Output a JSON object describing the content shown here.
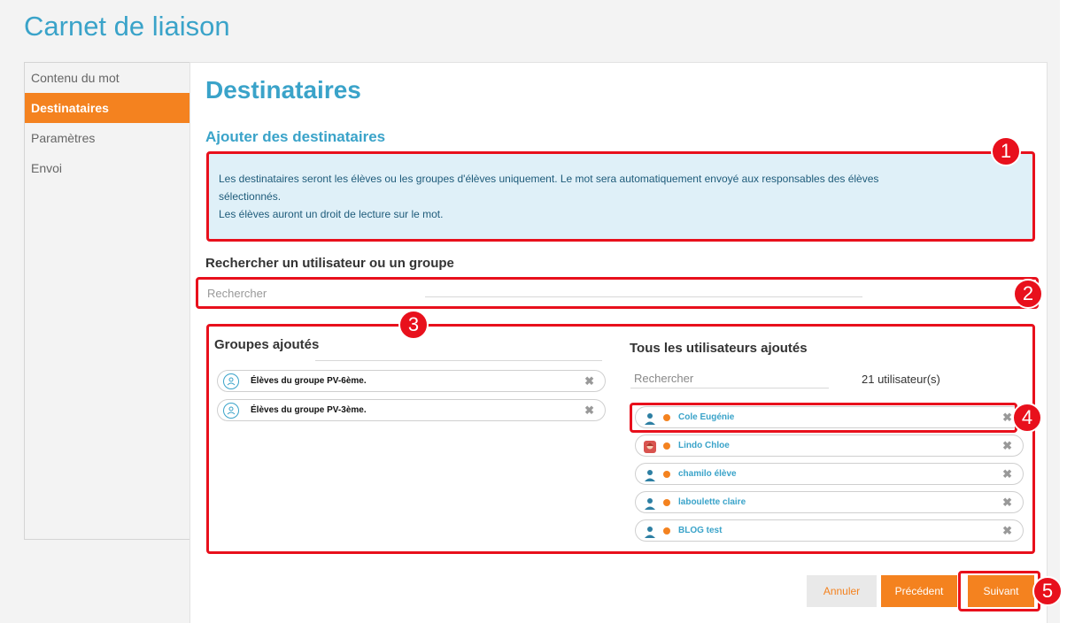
{
  "app": {
    "title": "Carnet de liaison"
  },
  "sidebar": {
    "items": [
      {
        "label": "Contenu du mot"
      },
      {
        "label": "Destinataires"
      },
      {
        "label": "Paramètres"
      },
      {
        "label": "Envoi"
      }
    ]
  },
  "main": {
    "title": "Destinataires",
    "subtitle": "Ajouter des destinataires",
    "info": {
      "line1": "Les destinataires seront les élèves ou les groupes d'élèves uniquement. Le mot sera automatiquement envoyé aux responsables des élèves",
      "line2": "sélectionnés.",
      "line3": "Les élèves auront un droit de lecture sur le mot."
    },
    "search": {
      "label": "Rechercher un utilisateur ou un groupe",
      "placeholder": "Rechercher"
    }
  },
  "groups": {
    "title": "Groupes ajoutés",
    "items": [
      {
        "label": "Élèves du groupe PV-6ème."
      },
      {
        "label": "Élèves du groupe PV-3ème."
      }
    ]
  },
  "users": {
    "title": "Tous les utilisateurs ajoutés",
    "search_placeholder": "Rechercher",
    "count": "21 utilisateur(s)",
    "items": [
      {
        "name": "Cole Eugénie",
        "avatar": "person-icon"
      },
      {
        "name": "Lindo Chloe",
        "avatar": "photo-avatar"
      },
      {
        "name": "chamilo élève",
        "avatar": "person-icon"
      },
      {
        "name": "laboulette claire",
        "avatar": "person-icon"
      },
      {
        "name": "BLOG test",
        "avatar": "person-icon"
      }
    ],
    "status_color": "#f4821f"
  },
  "buttons": {
    "cancel": "Annuler",
    "previous": "Précédent",
    "next": "Suivant"
  },
  "callouts": [
    "1",
    "2",
    "3",
    "4",
    "5"
  ],
  "colors": {
    "accent": "#3aa3c9",
    "orange": "#f4821f",
    "highlight": "#e8101c",
    "info_bg": "#dff0f8"
  }
}
